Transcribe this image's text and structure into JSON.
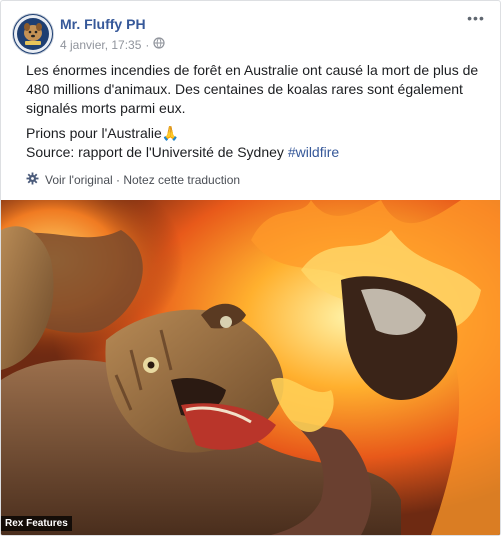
{
  "post": {
    "author": "Mr. Fluffy PH",
    "date": "4 janvier, 17:35",
    "separator": "·",
    "paragraph1": "Les énormes incendies de forêt en Australie ont causé la mort de plus de 480 millions d'animaux. Des centaines de koalas rares sont également signalés morts parmi eux.",
    "prayer_line": "Prions pour l'Australie🙏",
    "source_prefix": "Source: rapport de l'Université de Sydney ",
    "hashtag": "#wildfire",
    "see_original": "Voir l'original",
    "rate_translation": "Notez cette traduction",
    "dot": " · ",
    "menu": "•••"
  },
  "photo": {
    "credit": "Rex Features"
  },
  "icons": {
    "globe": "globe-icon",
    "gear": "gear-icon",
    "avatar": "avatar-logo-icon"
  },
  "colors": {
    "link": "#365899",
    "meta": "#90949c"
  }
}
